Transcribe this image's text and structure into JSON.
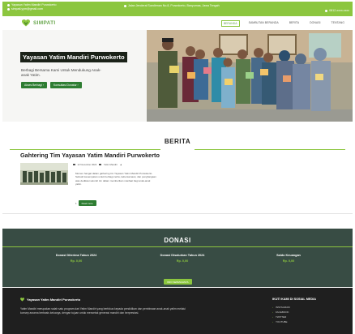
{
  "topbar": {
    "address_left": "Yayasan Yatim Mandiri Purwokerto",
    "email": "simpati.yym@gmail.com",
    "address_mid": "Jalan Jenderal Soedirman No.8, Purwokerto, Banyumas, Jawa Tengah",
    "phone": "0812-xxxx-xxxx"
  },
  "brand": {
    "name": "SIMPATI",
    "logo_icon": "heart-leaf-icon"
  },
  "nav": {
    "items": [
      "BERANDA",
      "SAMBUTAN BERANDA",
      "BERITA",
      "DONASI",
      "TENTANG"
    ],
    "active_index": 0
  },
  "hero": {
    "title": "Yayasan Yatim Mandiri Purwokerto",
    "subtitle": "Berbagi Bersama Kami Untuk Mendukung Anak-anak Yatim.",
    "btn_primary": "Akses Berbagi",
    "btn_secondary": "Konsultasi Donatur"
  },
  "berita": {
    "section_title": "BERITA",
    "post_title": "Gahtering Tim Yayasan Yatim Mandiri Purwokerto",
    "date": "12 November 2024",
    "author": "Yatim Mandiri",
    "excerpt": "Momen hangat dalam gathering tim Yayasan Yatim Mandiri Purwokerto. Sebuah kesempatan untuk berbagi cerita, kebersamaan, dan penghargaan atas dedikasi seluruh tim dalam memberikan manfaat bagi anak-anak yatim.",
    "read_more_num": "1",
    "read_more": "Read more"
  },
  "donasi": {
    "section_title": "DONASI",
    "stats": [
      {
        "label": "Donasi Diterima Tahun 2024",
        "value": "Rp. 0,00"
      },
      {
        "label": "Donasi Disalurkan Tahun 2024",
        "value": "Rp. 0,00"
      },
      {
        "label": "Saldo Keuangan",
        "value": "Rp. 0,00"
      }
    ],
    "button": "INFO SEPENUHNYA"
  },
  "footer": {
    "brand": "Yayasan Yatim Mandiri Purwokerto",
    "description": "Yatim Mandiri merupakan salah satu program dari Yatim Mandiri yang berfokus kepada pendidikan dan pembinaan anak-anak yatim melalui konsep asrama berbasis keluarga, dengan tujuan untuk mencetak generasi mandiri dan berprestasi.",
    "social_title": "IKUTI KAMI DI SOSIAL MEDIA",
    "social_links": [
      "INSTAGRAM",
      "FACEBOOK",
      "TWITTER",
      "YOUTUBE"
    ]
  },
  "colors": {
    "accent": "#8cc63f",
    "dark_green": "#2e7d32",
    "donasi_bg": "#384c44",
    "footer_bg": "#1f1f1f"
  }
}
